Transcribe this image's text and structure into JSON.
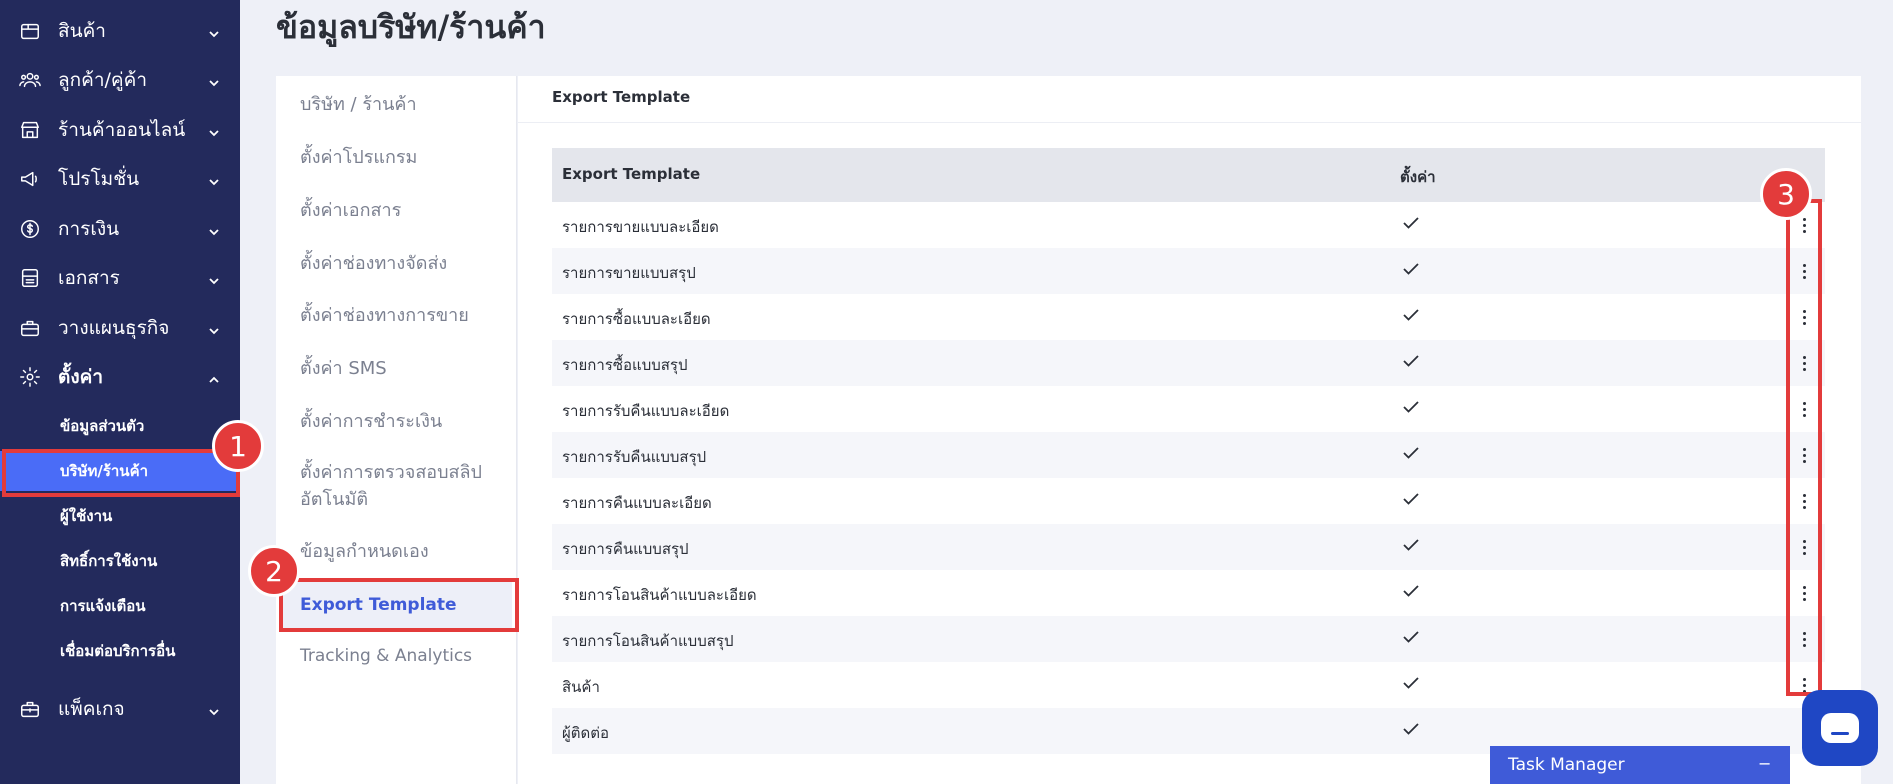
{
  "sidebar": {
    "items": [
      {
        "label": "สินค้า",
        "icon": "box-icon"
      },
      {
        "label": "ลูกค้า/คู่ค้า",
        "icon": "users-icon"
      },
      {
        "label": "ร้านค้าออนไลน์",
        "icon": "store-icon"
      },
      {
        "label": "โปรโมชั่น",
        "icon": "megaphone-icon"
      },
      {
        "label": "การเงิน",
        "icon": "coin-icon"
      },
      {
        "label": "เอกสาร",
        "icon": "document-icon"
      },
      {
        "label": "วางแผนธุรกิจ",
        "icon": "briefcase-icon"
      },
      {
        "label": "ตั้งค่า",
        "icon": "gear-icon"
      }
    ],
    "sub_items": [
      {
        "label": "ข้อมูลส่วนตัว"
      },
      {
        "label": "บริษัท/ร้านค้า",
        "active": true
      },
      {
        "label": "ผู้ใช้งาน"
      },
      {
        "label": "สิทธิ์การใช้งาน"
      },
      {
        "label": "การแจ้งเตือน"
      },
      {
        "label": "เชื่อมต่อบริการอื่น"
      }
    ],
    "package": {
      "label": "แพ็คเกจ",
      "icon": "package-icon"
    }
  },
  "page": {
    "title": "ข้อมูลบริษัท/ร้านค้า"
  },
  "settings_nav": [
    "บริษัท / ร้านค้า",
    "ตั้งค่าโปรแกรม",
    "ตั้งค่าเอกสาร",
    "ตั้งค่าช่องทางจัดส่ง",
    "ตั้งค่าช่องทางการขาย",
    "ตั้งค่า SMS",
    "ตั้งค่าการชำระเงิน",
    "ตั้งค่าการตรวจสอบสลิป",
    "อัตโนมัติ",
    "ข้อมูลกำหนดเอง",
    "Export Template",
    "Tracking & Analytics"
  ],
  "card": {
    "title": "Export Template"
  },
  "table": {
    "headers": [
      "Export Template",
      "ตั้งค่า"
    ],
    "rows": [
      "รายการขายแบบละเอียด",
      "รายการขายแบบสรุป",
      "รายการซื้อแบบละเอียด",
      "รายการซื้อแบบสรุป",
      "รายการรับคืนแบบละเอียด",
      "รายการรับคืนแบบสรุป",
      "รายการคืนแบบละเอียด",
      "รายการคืนแบบสรุป",
      "รายการโอนสินค้าแบบละเอียด",
      "รายการโอนสินค้าแบบสรุป",
      "สินค้า",
      "ผู้ติดต่อ"
    ]
  },
  "annotations": {
    "marker_1": "1",
    "marker_2": "2",
    "marker_3": "3",
    "color": "#e33b3b"
  },
  "task_manager": {
    "label": "Task Manager",
    "minimize": "−"
  },
  "colors": {
    "sidebar": "#232a5c",
    "accent": "#4a6cf7",
    "link_active": "#3f5bd8"
  }
}
